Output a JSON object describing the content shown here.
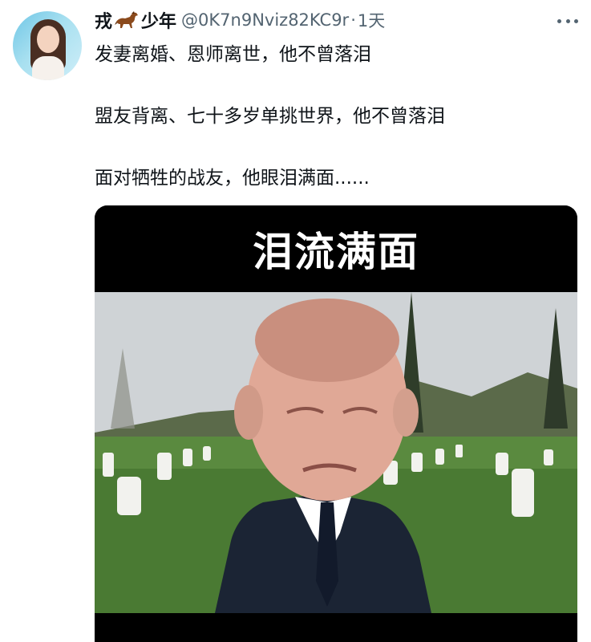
{
  "tweet": {
    "display_name_part1": "戎",
    "display_name_part2": "少年",
    "handle": "@0K7n9Nviz82KC9r",
    "separator": "·",
    "time": "1天",
    "lines": [
      "发妻离婚、恩师离世，他不曾落泪",
      "盟友背离、七十多岁单挑世界，他不曾落泪",
      "面对牺牲的战友，他眼泪满面......"
    ]
  },
  "media": {
    "caption": "泪流满面"
  },
  "icons": {
    "name_emoji": "horse-icon",
    "more": "more-icon"
  },
  "colors": {
    "text_primary": "#0f1419",
    "text_secondary": "#536471",
    "media_background": "#000000"
  }
}
